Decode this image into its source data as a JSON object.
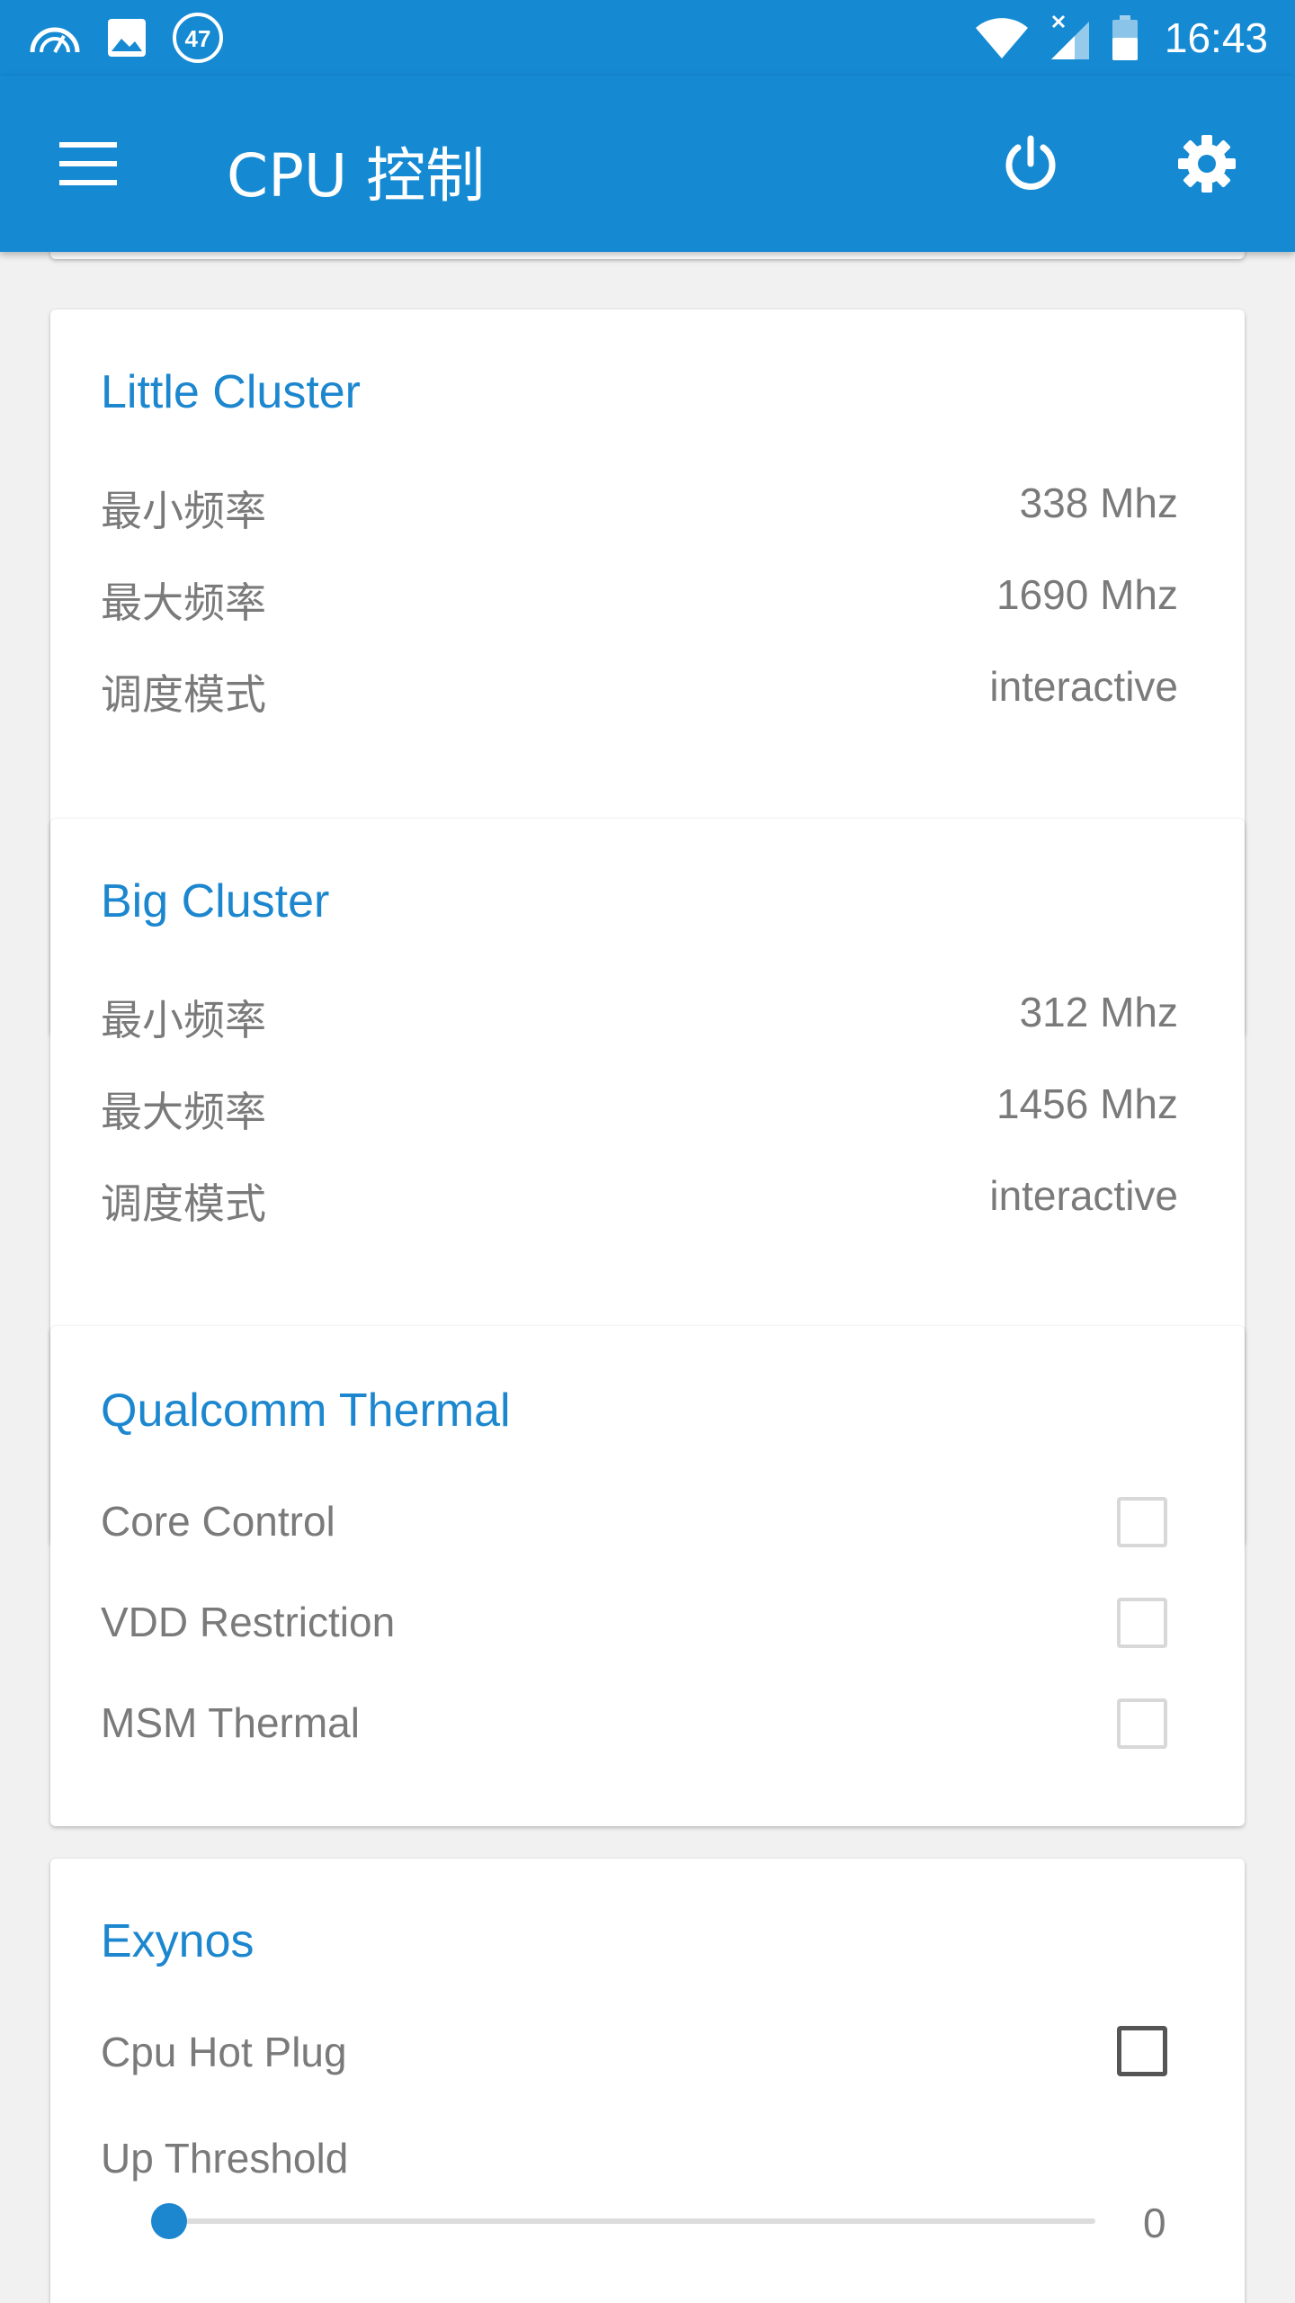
{
  "status_bar": {
    "icons_left": [
      "speedometer-icon",
      "image-icon",
      "badge-icon"
    ],
    "badge_text": "47",
    "icons_right": [
      "wifi-icon",
      "signal-icon",
      "battery-icon"
    ],
    "time": "16:43"
  },
  "app_bar": {
    "title": "CPU 控制",
    "icons": [
      "menu-icon",
      "power-icon",
      "gear-icon"
    ],
    "color": "#158ad3"
  },
  "cards": {
    "little": {
      "title": "Little Cluster",
      "rows": [
        {
          "label": "最小频率",
          "value": "338 Mhz"
        },
        {
          "label": "最大频率",
          "value": "1690 Mhz"
        },
        {
          "label": "调度模式",
          "value": "interactive"
        }
      ]
    },
    "big": {
      "title": "Big Cluster",
      "rows": [
        {
          "label": "最小频率",
          "value": "312 Mhz"
        },
        {
          "label": "最大频率",
          "value": "1456 Mhz"
        },
        {
          "label": "调度模式",
          "value": "interactive"
        }
      ]
    },
    "thermal": {
      "title": "Qualcomm Thermal",
      "rows": [
        {
          "label": "Core Control",
          "checked": false
        },
        {
          "label": "VDD Restriction",
          "checked": false
        },
        {
          "label": "MSM Thermal",
          "checked": false
        }
      ]
    },
    "exynos": {
      "title": "Exynos",
      "hotplug": {
        "label": "Cpu Hot Plug",
        "checked": false
      },
      "threshold": {
        "label": "Up Threshold",
        "value": "0",
        "level": 0
      }
    }
  },
  "accent_color": "#1c87cf"
}
